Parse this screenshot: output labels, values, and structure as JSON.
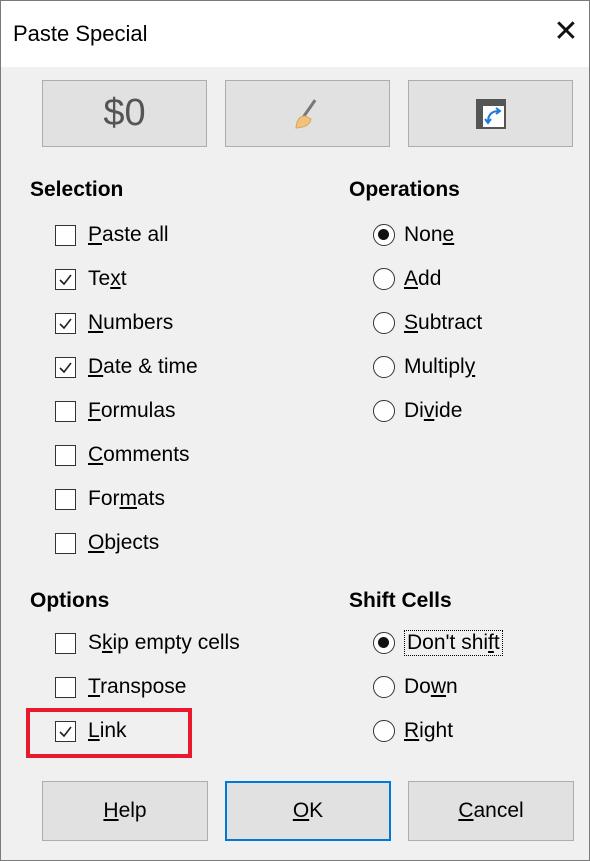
{
  "window": {
    "title": "Paste Special",
    "close_symbol": "✕"
  },
  "presets": [
    {
      "label": "$0",
      "icon": "values-only"
    },
    {
      "icon": "paint-brush-formats-only"
    },
    {
      "icon": "transpose-icon"
    }
  ],
  "selection": {
    "heading": "Selection",
    "items": [
      {
        "pre": "",
        "u": "P",
        "post": "aste all",
        "checked": false
      },
      {
        "pre": "Te",
        "u": "x",
        "post": "t",
        "checked": true
      },
      {
        "pre": "",
        "u": "N",
        "post": "umbers",
        "checked": true
      },
      {
        "pre": "",
        "u": "D",
        "post": "ate & time",
        "checked": true
      },
      {
        "pre": "",
        "u": "F",
        "post": "ormulas",
        "checked": false
      },
      {
        "pre": "",
        "u": "C",
        "post": "omments",
        "checked": false
      },
      {
        "pre": "For",
        "u": "m",
        "post": "ats",
        "checked": false
      },
      {
        "pre": "",
        "u": "O",
        "post": "bjects",
        "checked": false
      }
    ]
  },
  "operations": {
    "heading": "Operations",
    "items": [
      {
        "pre": "Non",
        "u": "e",
        "post": "",
        "selected": true
      },
      {
        "pre": "",
        "u": "A",
        "post": "dd",
        "selected": false
      },
      {
        "pre": "",
        "u": "S",
        "post": "ubtract",
        "selected": false
      },
      {
        "pre": "Multipl",
        "u": "y",
        "post": "",
        "selected": false
      },
      {
        "pre": "Di",
        "u": "v",
        "post": "ide",
        "selected": false
      }
    ]
  },
  "options": {
    "heading": "Options",
    "items": [
      {
        "pre": "S",
        "u": "k",
        "post": "ip empty cells",
        "checked": false
      },
      {
        "pre": "",
        "u": "T",
        "post": "ranspose",
        "checked": false
      },
      {
        "pre": "",
        "u": "L",
        "post": "ink",
        "checked": true
      }
    ]
  },
  "shift_cells": {
    "heading": "Shift Cells",
    "items": [
      {
        "pre": "Don't shi",
        "u": "f",
        "post": "t",
        "selected": true
      },
      {
        "pre": "Do",
        "u": "w",
        "post": "n",
        "selected": false
      },
      {
        "pre": "",
        "u": "R",
        "post": "ight",
        "selected": false
      }
    ]
  },
  "buttons": {
    "help": {
      "pre": "",
      "u": "H",
      "post": "elp"
    },
    "ok": {
      "pre": "",
      "u": "O",
      "post": "K"
    },
    "cancel": {
      "pre": "",
      "u": "C",
      "post": "ancel"
    }
  },
  "colors": {
    "highlight": "#e8192c",
    "default_button_border": "#0078d7"
  }
}
